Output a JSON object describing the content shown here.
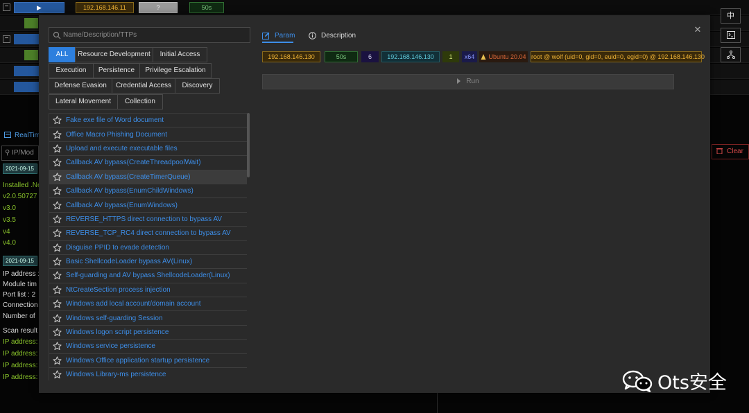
{
  "topbar": {
    "minus": "−",
    "play_icon": "▶",
    "ip": "192.168.146.11",
    "unknown": "?",
    "time": "50s"
  },
  "side_buttons": [
    "中",
    "terminal-icon",
    "network-icon"
  ],
  "realtime": {
    "title": "RealTim",
    "search_placeholder": "IP/Mod",
    "date1": "2021-09-15",
    "lines_green": [
      "Installed .Ne",
      "v2.0.50727",
      "v3.0",
      "v3.5",
      "v4",
      "v4.0"
    ],
    "date2": "2021-09-15",
    "lines_white": [
      "IP address :",
      "Module tim",
      "Port list : 2",
      "Connection",
      "Number of"
    ],
    "scan_result": "Scan result",
    "lines_ip": [
      "IP address:",
      "IP address:",
      "IP address:",
      "IP address:"
    ],
    "clear_label": "Clear"
  },
  "modal": {
    "search_placeholder": "Name/Description/TTPs",
    "tags": [
      [
        "ALL",
        "Resource Development",
        "Initial Access"
      ],
      [
        "Execution",
        "Persistence",
        "Privilege Escalation"
      ],
      [
        "Defense Evasion",
        "Credential Access",
        "Discovery"
      ],
      [
        "Lateral Movement",
        "Collection"
      ]
    ],
    "active_tag": "ALL",
    "modules": [
      "Fake exe file of Word document",
      "Office Macro Phishing Document",
      "Upload and execute executable files",
      "Callback AV bypass(CreateThreadpoolWait)",
      "Callback AV bypass(CreateTimerQueue)",
      "Callback AV bypass(EnumChildWindows)",
      "Callback AV bypass(EnumWindows)",
      "REVERSE_HTTPS direct connection to bypass AV",
      "REVERSE_TCP_RC4 direct connection to bypass AV",
      "Disguise PPID to evade detection",
      "Basic ShellcodeLoader bypass AV(Linux)",
      "Self-guarding and AV bypass ShellcodeLoader(Linux)",
      "NtCreateSection process injection",
      "Windows add local account/domain account",
      "Windows self-guarding Session",
      "Windows logon script persistence",
      "Windows service persistence",
      "Windows Office application startup persistence",
      "Windows Library-ms persistence"
    ],
    "tabs": {
      "param": "Param",
      "description": "Description",
      "active": "Param"
    },
    "close": "✕",
    "session": {
      "ip": "192.168.146.130",
      "time": "50s",
      "id": "6",
      "ip2": "192.168.146.130",
      "pid": "1",
      "arch": "x64",
      "os": "Ubuntu 20.04",
      "user": "root @ wolf (uid=0, gid=0, euid=0, egid=0) @ 192.168.146.130"
    },
    "run_label": "Run"
  },
  "watermark": "Ots安全",
  "colors": {
    "accent": "#3d8ee8",
    "active_tag": "#2d7fde",
    "ip_orange": "#f0b437",
    "green": "#8ac42b"
  }
}
